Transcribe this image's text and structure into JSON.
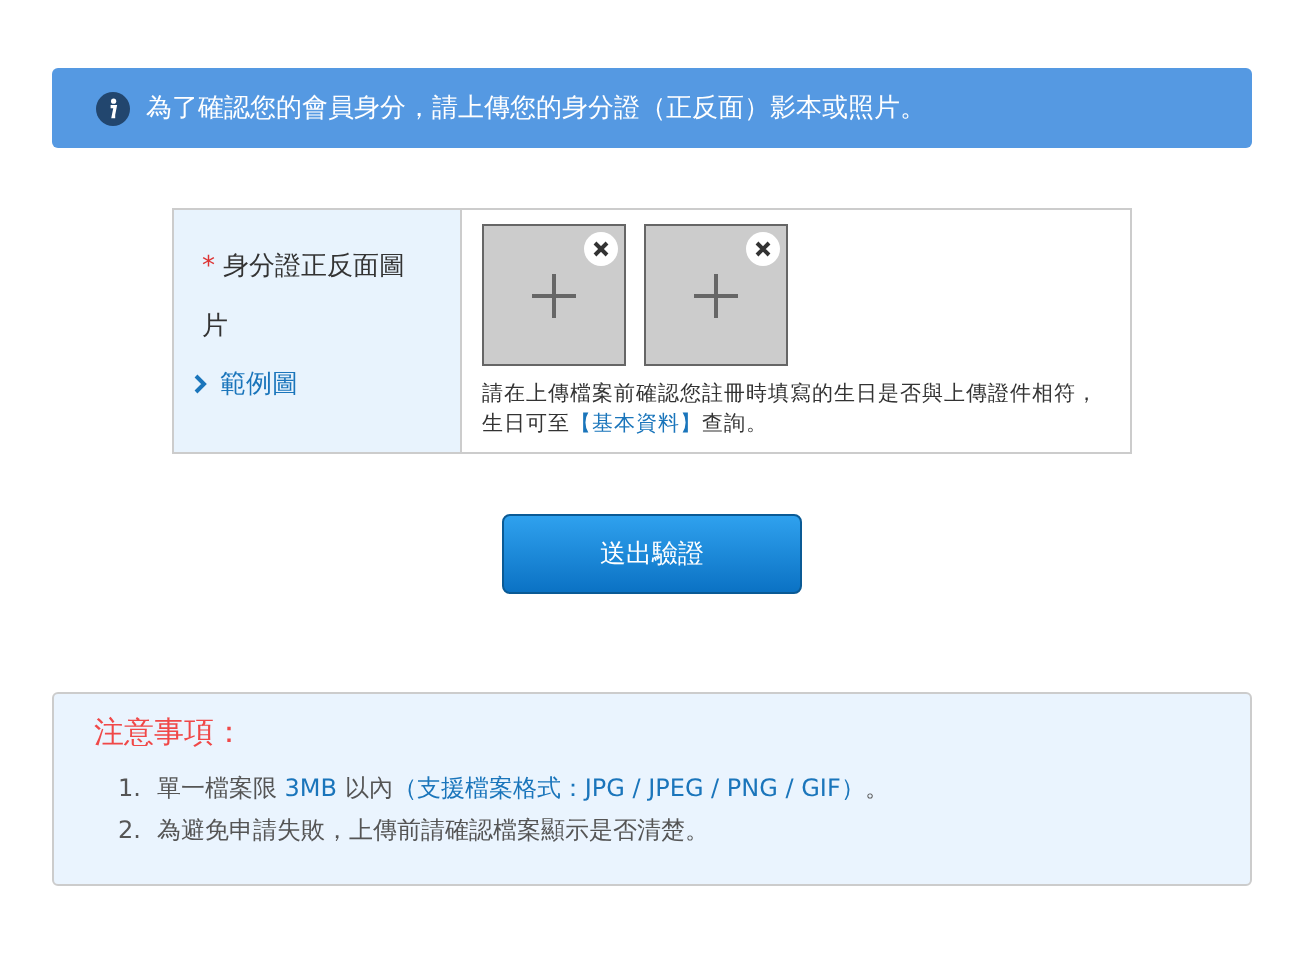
{
  "info_banner": {
    "text": "為了確認您的會員身分，請上傳您的身分證（正反面）影本或照片。"
  },
  "upload_form": {
    "required_mark": "*",
    "label": "身分證正反面圖片",
    "example_link": "範例圖",
    "slots": [
      {
        "kind": "empty"
      },
      {
        "kind": "empty"
      }
    ],
    "hint_before": "請在上傳檔案前確認您註冊時填寫的生日是否與上傳證件相符，生日可至",
    "hint_link": "【基本資料】",
    "hint_after": "查詢。"
  },
  "submit_button": "送出驗證",
  "notes": {
    "title": "注意事項：",
    "items": [
      {
        "number": "1.",
        "parts": [
          {
            "text": "單一檔案限 ",
            "accent": false
          },
          {
            "text": "3MB",
            "accent": true
          },
          {
            "text": " 以內",
            "accent": false
          },
          {
            "text": "（支援檔案格式：JPG / JPEG / PNG / GIF）",
            "accent": true
          },
          {
            "text": "。",
            "accent": false
          }
        ]
      },
      {
        "number": "2.",
        "parts": [
          {
            "text": "為避免申請失敗，上傳前請確認檔案顯示是否清楚。",
            "accent": false
          }
        ]
      }
    ]
  }
}
